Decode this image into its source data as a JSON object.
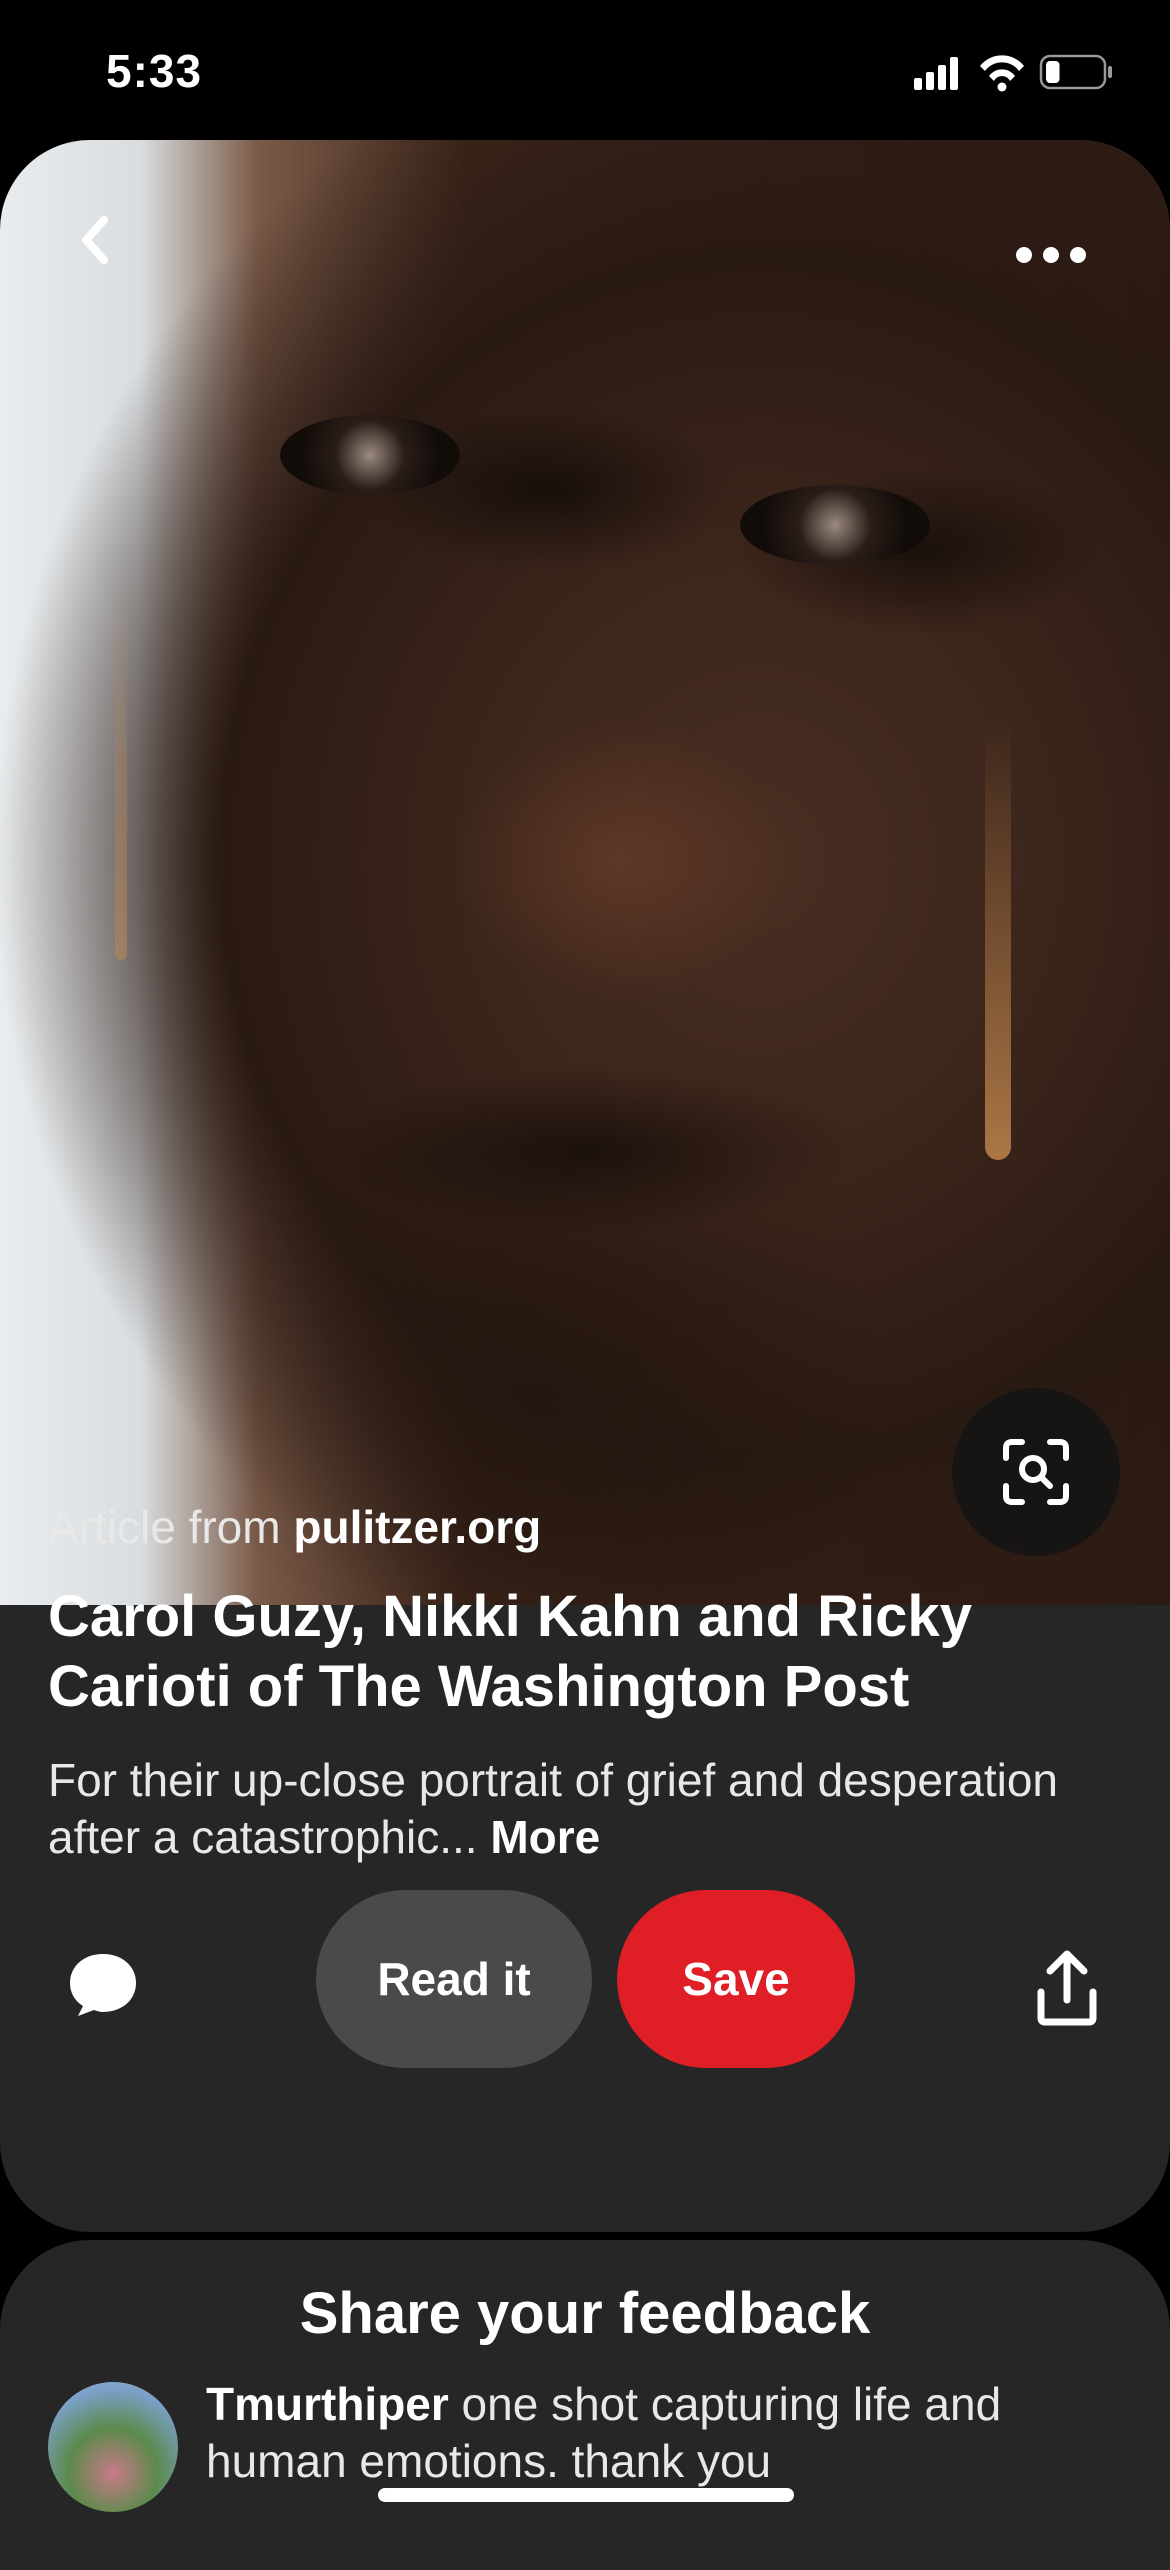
{
  "status_bar": {
    "time": "5:33",
    "battery_level": 0.25
  },
  "toolbar": {
    "back_icon": "chevron-left-icon",
    "more_icon": "ellipsis-icon",
    "lens_icon": "visual-search-icon"
  },
  "pin": {
    "source_prefix": "Article from ",
    "source_domain": "pulitzer.org",
    "title": "Carol Guzy, Nikki Kahn and Ricky Carioti of The Washington Post",
    "description": "For their up-close portrait of grief and desperation after a catastrophic... ",
    "more_label": "More"
  },
  "actions": {
    "read_label": "Read it",
    "save_label": "Save",
    "save_color": "#e01e26"
  },
  "feedback": {
    "title": "Share your feedback",
    "comment_user": "Tmurthiper",
    "comment_text": " one shot capturing life and human emotions. thank you"
  }
}
